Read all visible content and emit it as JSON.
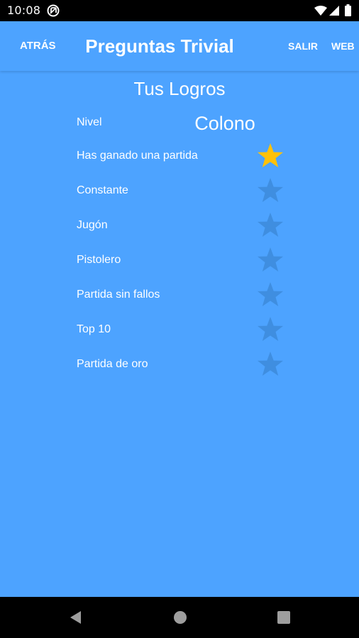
{
  "status_bar": {
    "time": "10:08",
    "icons": [
      "notification-icon",
      "wifi-icon",
      "signal-icon",
      "battery-icon"
    ]
  },
  "app_bar": {
    "back_label": "ATRÁS",
    "title": "Preguntas Trivial",
    "exit_label": "SALIR",
    "web_label": "WEB"
  },
  "content": {
    "section_title": "Tus Logros",
    "level_label": "Nivel",
    "level_value": "Colono",
    "achievements": [
      {
        "label": "Has ganado una partida",
        "achieved": true
      },
      {
        "label": "Constante",
        "achieved": false
      },
      {
        "label": "Jugón",
        "achieved": false
      },
      {
        "label": "Pistolero",
        "achieved": false
      },
      {
        "label": "Partida sin fallos",
        "achieved": false
      },
      {
        "label": "Top 10",
        "achieved": false
      },
      {
        "label": "Partida de oro",
        "achieved": false
      }
    ]
  },
  "nav_bar": {
    "icons": [
      "back-triangle-icon",
      "home-circle-icon",
      "recents-square-icon"
    ]
  },
  "colors": {
    "background": "#4da3ff",
    "star_achieved": "#ffc107",
    "star_locked": "#3f8ee0",
    "system_bars": "#000000"
  }
}
